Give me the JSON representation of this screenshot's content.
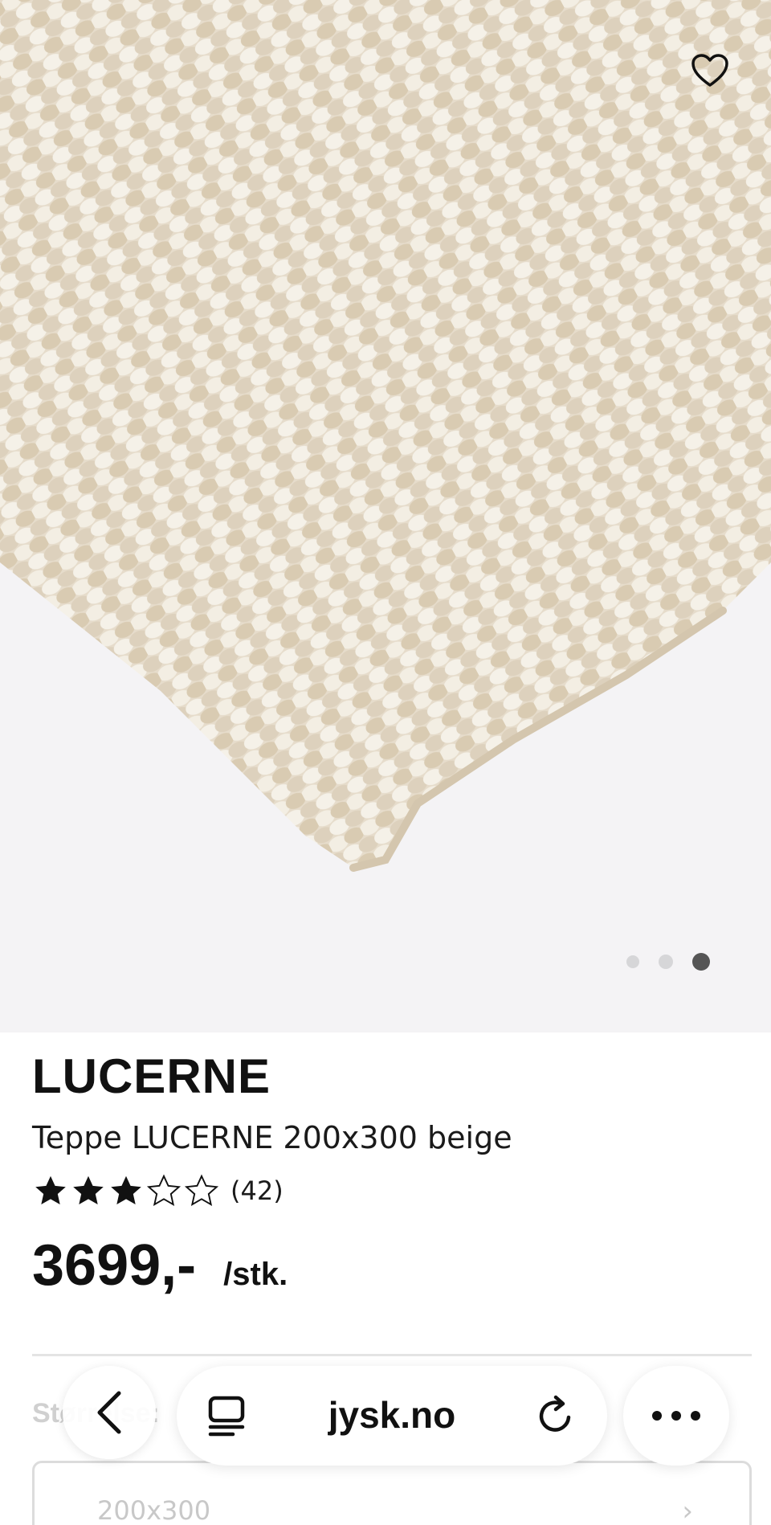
{
  "product": {
    "brand": "LUCERNE",
    "title": "Teppe LUCERNE 200x300 beige",
    "rating": {
      "value": 3,
      "max": 5,
      "count_label": "(42)"
    },
    "price": "3699,-",
    "unit": "/stk."
  },
  "gallery": {
    "total": 3,
    "active_index": 3
  },
  "size": {
    "label": "Størrelse:",
    "selected": "200x300"
  },
  "browser": {
    "url": "jysk.no"
  },
  "colors": {
    "image_background": "#f4f3f5",
    "rug": "#e8e0d2",
    "text": "#111111",
    "active_dot": "#555555"
  }
}
